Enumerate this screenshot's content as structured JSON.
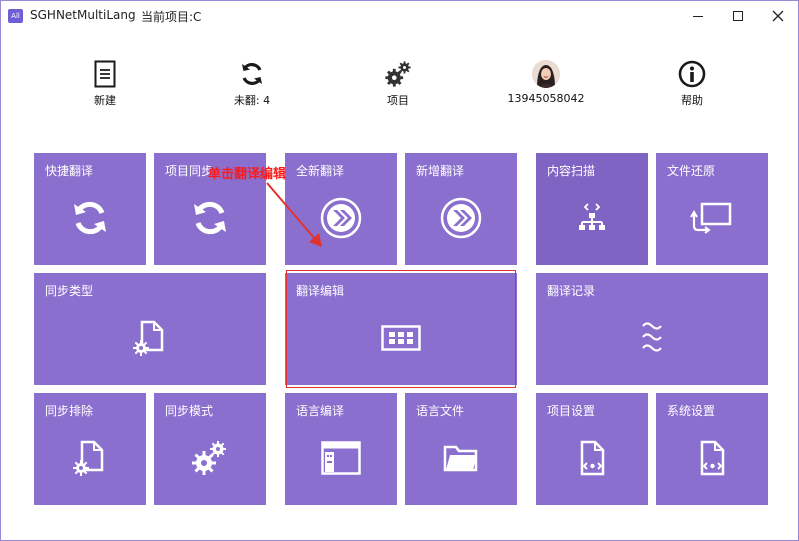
{
  "window": {
    "app_title": "SGHNetMultiLang",
    "project_label": "当前项目:C",
    "app_icon_text": "All"
  },
  "toolbar": {
    "items": [
      {
        "label": "新建",
        "icon": "document-icon"
      },
      {
        "label": "未翻: 4",
        "icon": "refresh-icon"
      },
      {
        "label": "项目",
        "icon": "gears-icon"
      },
      {
        "label": "13945058042",
        "icon": "avatar"
      },
      {
        "label": "帮助",
        "icon": "info-icon"
      }
    ]
  },
  "tiles": [
    {
      "label": "快捷翻译",
      "icon": "sync-icon"
    },
    {
      "label": "项目同步",
      "icon": "sync-icon"
    },
    {
      "label": "全新翻译",
      "icon": "chevrons-circle-icon"
    },
    {
      "label": "新增翻译",
      "icon": "chevrons-circle-icon"
    },
    {
      "label": "内容扫描",
      "icon": "network-scan-icon"
    },
    {
      "label": "文件还原",
      "icon": "restore-icon"
    },
    {
      "label": "同步类型",
      "icon": "file-gear-icon"
    },
    {
      "label": "翻译编辑",
      "icon": "grid-editor-icon"
    },
    {
      "label": "翻译记录",
      "icon": "waves-icon"
    },
    {
      "label": "同步排除",
      "icon": "file-gear-icon"
    },
    {
      "label": "同步模式",
      "icon": "gears-icon"
    },
    {
      "label": "语言编译",
      "icon": "window-compile-icon"
    },
    {
      "label": "语言文件",
      "icon": "folder-icon"
    },
    {
      "label": "项目设置",
      "icon": "file-code-icon"
    },
    {
      "label": "系统设置",
      "icon": "file-code-icon"
    }
  ],
  "annotation": {
    "text": "单击翻译编辑",
    "color": "#ff1a1a"
  },
  "colors": {
    "tile": "#8b6fcf",
    "tile_dark": "#7f64c4",
    "accent": "#6f5fd6"
  }
}
